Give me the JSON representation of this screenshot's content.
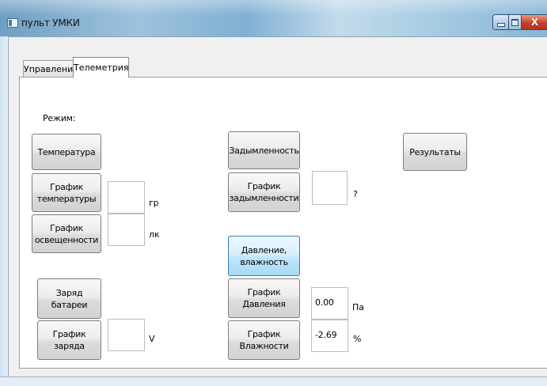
{
  "window": {
    "title": "пульт УМКИ",
    "close_glyph": "X"
  },
  "tabs": [
    {
      "label": "Управление",
      "active": false
    },
    {
      "label": "Телеметрия",
      "active": true
    }
  ],
  "telemetry": {
    "mode_label": "Режим:",
    "temperature_button": "Температура",
    "temp_chart_button": "График температуры",
    "temp_value": "",
    "temp_unit": "гр",
    "light_chart_button": "График освещенности",
    "light_value": "",
    "light_unit": "лк",
    "battery_button": "Заряд батареи",
    "charge_chart_button": "График заряда",
    "charge_value": "",
    "charge_unit": "V",
    "smoke_button": "Задымленность",
    "smoke_chart_button": "График задымленности",
    "smoke_value": "",
    "smoke_unit": "?",
    "pressure_humidity_button": "Давление, влажность",
    "pressure_chart_button": "График Давления",
    "pressure_value": "0.00",
    "pressure_unit": "Па",
    "humidity_chart_button": "График Влажности",
    "humidity_value": "-2.69",
    "humidity_unit": "%",
    "results_button": "Результаты"
  },
  "colors": {
    "active_button": "#bee6fd",
    "close_button": "#c8402a"
  }
}
